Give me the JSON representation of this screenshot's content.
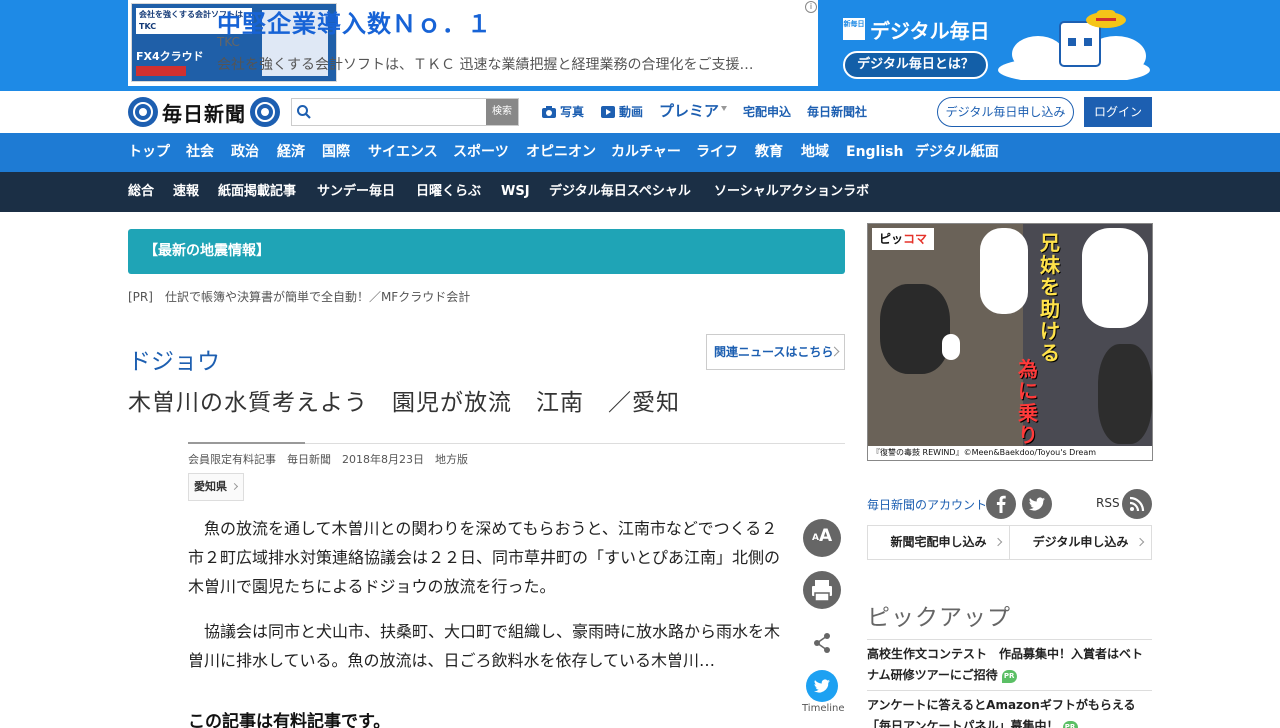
{
  "ad_banner": {
    "thumb_text": "会社を強くする会計ソフトは TKC",
    "thumb_product": "FX4クラウド",
    "title": "中堅企業導入数Ｎｏ．１",
    "advertiser": "TKC",
    "description": "会社を強くする会計ソフトは、ＴＫＣ 迅速な業績把握と経理業務の合理化をご支援…",
    "choice_icon": "ad-choices-icon"
  },
  "digital_mainichi": {
    "badge": "新毎日",
    "logo": "デジタル毎日",
    "button": "デジタル毎日とは？"
  },
  "header": {
    "logo_text": "毎日新聞",
    "search_placeholder": "",
    "search_button": "検索",
    "nav": {
      "photo": "写真",
      "video": "動画",
      "premia": "プレミア",
      "delivery": "宅配申込",
      "company": "毎日新聞社"
    },
    "apply_button": "デジタル毎日申し込み",
    "login_button": "ログイン"
  },
  "nav_primary": [
    "トップ",
    "社会",
    "政治",
    "経済",
    "国際",
    "サイエンス",
    "スポーツ",
    "オピニオン",
    "カルチャー",
    "ライフ",
    "教育",
    "地域",
    "English",
    "デジタル紙面"
  ],
  "nav_secondary": [
    "総合",
    "速報",
    "紙面掲載記事",
    "サンデー毎日",
    "日曜くらぶ",
    "WSJ",
    "デジタル毎日スペシャル",
    "ソーシャルアクションラボ"
  ],
  "quake_banner": "【最新の地震情報】",
  "pr_line": "[PR]　仕訳で帳簿や決算書が簡単で全自動！／MFクラウド会計",
  "article": {
    "kicker": "ドジョウ",
    "related_button": "関連ニュースはこちら",
    "headline": "木曽川の水質考えよう　園児が放流　江南　／愛知",
    "meta": "会員限定有料記事　毎日新聞　2018年8月23日　地方版",
    "tag": "愛知県",
    "paragraphs": [
      "魚の放流を通して木曽川との関わりを深めてもらおうと、江南市などでつくる２市２町広域排水対策連絡協議会は２２日、同市草井町の「すいとぴあ江南」北側の木曽川で園児たちによるドジョウの放流を行った。",
      "協議会は同市と犬山市、扶桑町、大口町で組織し、豪雨時に放水路から雨水を木曽川に排水している。魚の放流は、日ごろ飲料水を依存している木曽川…"
    ],
    "paid_note": "この記事は有料記事です。"
  },
  "tools": {
    "font_label": "A",
    "font_small": "A",
    "twitter_label": "Timeline"
  },
  "sidebar": {
    "manga": {
      "logo_a": "ピッ",
      "logo_b": "コマ",
      "headline_a": "兄妹を助ける",
      "headline_b": "為に乗り込む!!",
      "caption": "『復讐の毒鼓 REWIND』©Meen&Baekdoo/Toyou's Dream"
    },
    "account_label": "毎日新聞のアカウント",
    "rss_label": "RSS",
    "sub_buttons": [
      "新聞宅配申し込み",
      "デジタル申し込み"
    ],
    "pickup_title": "ピックアップ",
    "pickup_items": [
      "高校生作文コンテスト　作品募集中！入賞者はベトナム研修ツアーにご招待",
      "アンケートに答えるとAmazonギフトがもらえる「毎日アンケートパネル」募集中！"
    ],
    "pr_badge": "PR"
  },
  "colors": {
    "brand_blue": "#1d5fb1",
    "ad_blue": "#1e8ae6",
    "nav_primary_bg": "#1e7bd4",
    "nav_secondary_bg": "#1b2f45",
    "quake_bg": "#1fa4b6"
  }
}
